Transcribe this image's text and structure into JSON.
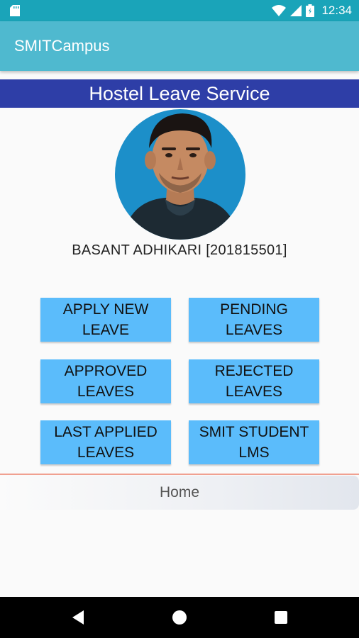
{
  "status_bar": {
    "time": "12:34",
    "icons": [
      "sd-card-icon",
      "wifi-icon",
      "cell-signal-icon",
      "battery-icon"
    ]
  },
  "app_bar": {
    "title": "SMITCampus"
  },
  "banner": {
    "title": "Hostel Leave Service"
  },
  "profile": {
    "name": "BASANT ADHIKARI [201815501]"
  },
  "menu": {
    "apply_new_leave": "APPLY NEW\nLEAVE",
    "pending_leaves": "PENDING\nLEAVES",
    "approved_leaves": "APPROVED\nLEAVES",
    "rejected_leaves": "REJECTED\nLEAVES",
    "last_applied_leaves": "LAST APPLIED\nLEAVES",
    "smit_student_lms": "SMIT STUDENT\nLMS"
  },
  "bottom_tab": {
    "label": "Home"
  },
  "nav_bar": {
    "icons": [
      "back-icon",
      "home-icon",
      "recents-icon"
    ]
  },
  "colors": {
    "status_bar": "#1aa4b9",
    "app_bar": "#4fb9cf",
    "banner": "#2e3ea7",
    "button": "#5bbcfb"
  }
}
